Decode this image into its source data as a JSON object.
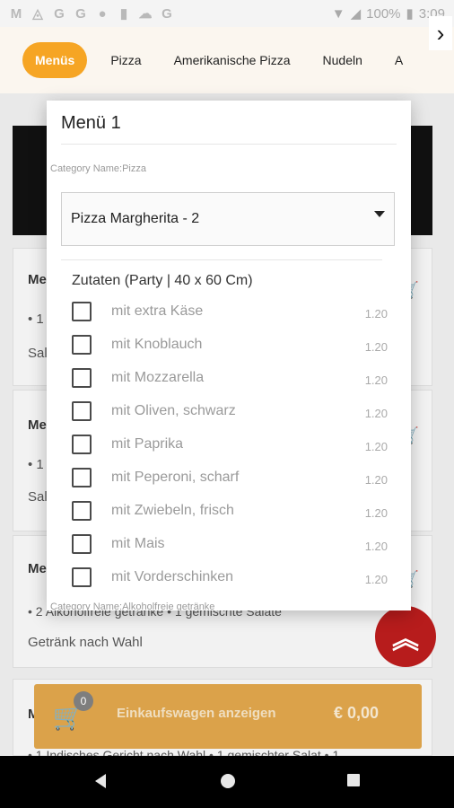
{
  "status_bar": {
    "battery": "100%",
    "time": "3:09",
    "icons": [
      "gmail-icon",
      "alert-icon",
      "google-g-icon",
      "google-g-icon",
      "circle-icon",
      "sd-card-icon",
      "cloud-icon",
      "google-g-icon"
    ]
  },
  "categories": {
    "items": [
      {
        "label": "Menüs",
        "active": true
      },
      {
        "label": "Pizza",
        "active": false
      },
      {
        "label": "Amerikanische Pizza",
        "active": false
      },
      {
        "label": "Nudeln",
        "active": false
      },
      {
        "label": "A",
        "active": false
      }
    ],
    "active_color": "#f6a524"
  },
  "background": {
    "cards": [
      {
        "title": "Me",
        "line1": "• 1",
        "line2": "Sal"
      },
      {
        "title": "Me",
        "line1": "• 1",
        "line2": "Sal"
      },
      {
        "title": "Me",
        "line1": "• 2 Alkoholfreie getränke • 1 gemischte Salate",
        "line2": "Getränk nach Wahl"
      },
      {
        "title": "Me",
        "line1": "• 1 Indisches Gericht nach Wahl • 1 gemischter Salat • 1"
      }
    ]
  },
  "dialog": {
    "title": "Menü 1",
    "category_1": "Category Name:Pizza",
    "selected_pizza": "Pizza Margherita - 2",
    "group_title": "Zutaten (Party | 40 x 60 Cm)",
    "ingredients": [
      {
        "name": "mit extra Käse",
        "price": "1.20",
        "checked": false
      },
      {
        "name": "mit Knoblauch",
        "price": "1.20",
        "checked": false
      },
      {
        "name": "mit Mozzarella",
        "price": "1.20",
        "checked": false
      },
      {
        "name": "mit Oliven, schwarz",
        "price": "1.20",
        "checked": false
      },
      {
        "name": "mit Paprika",
        "price": "1.20",
        "checked": false
      },
      {
        "name": "mit Peperoni, scharf",
        "price": "1.20",
        "checked": false
      },
      {
        "name": "mit Zwiebeln, frisch",
        "price": "1.20",
        "checked": false
      },
      {
        "name": "mit Mais",
        "price": "1.20",
        "checked": false
      },
      {
        "name": "mit Vorderschinken",
        "price": "1.20",
        "checked": false
      }
    ],
    "category_2": "Category Name:Alkoholfreie getränke"
  },
  "cart": {
    "count": "0",
    "label": "Einkaufswagen anzeigen",
    "total": "€ 0,00",
    "color": "#dba24a"
  },
  "fab": {
    "icon": "double-chevron-up-icon",
    "color": "#b71c1c"
  }
}
